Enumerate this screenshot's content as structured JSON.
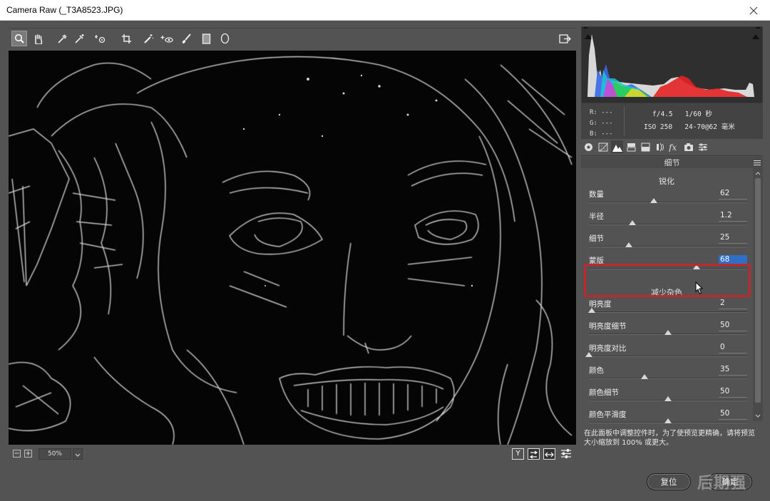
{
  "window": {
    "title": "Camera Raw (_T3A8523.JPG)"
  },
  "toolbar": {
    "tools": [
      "zoom-icon",
      "hand-icon",
      "white-balance-icon",
      "color-sampler-icon",
      "target-adjust-icon",
      "crop-icon",
      "spot-removal-icon",
      "redeye-icon",
      "adjustment-brush-icon",
      "graduated-filter-icon",
      "radial-filter-icon"
    ],
    "right_tool": "open-preferences-icon"
  },
  "histogram": {
    "r_label": "R:",
    "g_label": "G:",
    "b_label": "B:",
    "r_value": "---",
    "g_value": "---",
    "b_value": "---",
    "aperture": "f/4.5",
    "shutter": "1/60 秒",
    "iso": "ISO 250",
    "lens": "24-70@62 毫米"
  },
  "panel": {
    "title": "细节",
    "sharpen_heading": "锐化",
    "noise_heading": "减少杂色"
  },
  "sharpen": [
    {
      "label": "数量",
      "value": "62",
      "level": 0.408
    },
    {
      "label": "半径",
      "value": "1.2",
      "level": 0.273
    },
    {
      "label": "细节",
      "value": "25",
      "level": 0.25
    },
    {
      "label": "蒙版",
      "value": "68",
      "level": 0.68
    }
  ],
  "noise": [
    {
      "label": "明亮度",
      "value": "2",
      "level": 0.02
    },
    {
      "label": "明亮度细节",
      "value": "50",
      "level": 0.5
    },
    {
      "label": "明亮度对比",
      "value": "0",
      "level": 0.0
    },
    {
      "label": "颜色",
      "value": "35",
      "level": 0.35
    },
    {
      "label": "颜色细节",
      "value": "50",
      "level": 0.5
    },
    {
      "label": "颜色平滑度",
      "value": "50",
      "level": 0.5
    }
  ],
  "hint": "在此面板中调整控件时，为了使预览更精确，请将预览大小缩放到 100% 或更大。",
  "zoom": {
    "value": "50%",
    "minus": "−",
    "plus": "+"
  },
  "view_buttons": {
    "y": "Y"
  },
  "buttons": {
    "reset": "复位",
    "ok": "确定"
  },
  "watermark": "后期强",
  "colors": {
    "highlight_box": "#c0282d",
    "value_highlight": "#2f6fc6"
  }
}
